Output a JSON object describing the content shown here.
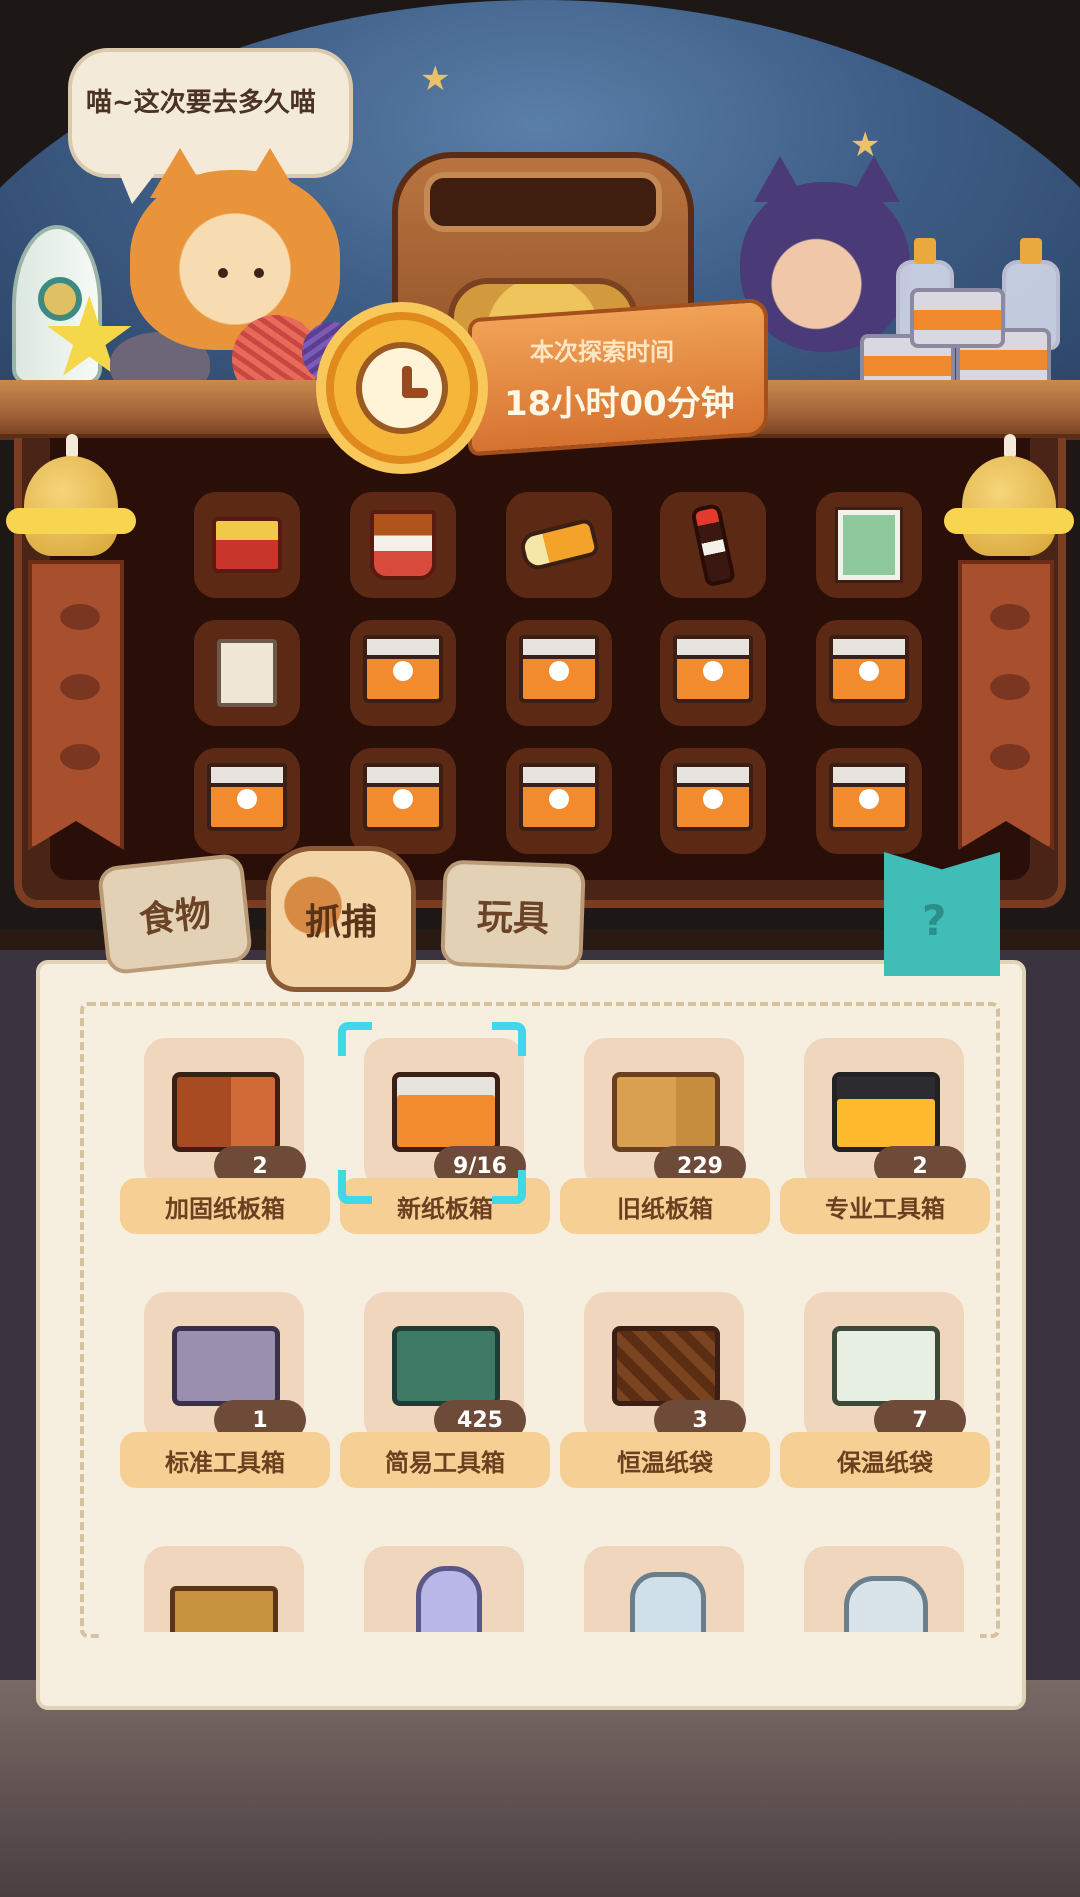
{
  "scene": {
    "speech": "喵~这次要去多久喵",
    "timer_label": "本次探索时间",
    "timer_value": "18小时00分钟"
  },
  "tabs": [
    {
      "label": "食物",
      "selected": false
    },
    {
      "label": "抓捕",
      "selected": true
    },
    {
      "label": "玩具",
      "selected": false
    }
  ],
  "cabinet_items": [
    "food-basket-icon",
    "fried-chicken-bucket-icon",
    "flashlight-icon",
    "soda-bottle-icon",
    "portrait-card-icon",
    "order-note-icon",
    "new-cardboard-box-icon",
    "new-cardboard-box-icon",
    "new-cardboard-box-icon",
    "new-cardboard-box-icon",
    "new-cardboard-box-icon",
    "new-cardboard-box-icon",
    "new-cardboard-box-icon",
    "new-cardboard-box-icon",
    "new-cardboard-box-icon"
  ],
  "items": [
    {
      "name": "加固纸板箱",
      "qty": "2"
    },
    {
      "name": "新纸板箱",
      "qty": "9/16",
      "selected": true
    },
    {
      "name": "旧纸板箱",
      "qty": "229"
    },
    {
      "name": "专业工具箱",
      "qty": "2"
    },
    {
      "name": "标准工具箱",
      "qty": "1"
    },
    {
      "name": "简易工具箱",
      "qty": "425"
    },
    {
      "name": "恒温纸袋",
      "qty": "3"
    },
    {
      "name": "保温纸袋",
      "qty": "7"
    }
  ],
  "colors": {
    "selection": "#41d6e8",
    "tag_bg": "#f6cf95",
    "qty_bg": "#6e4a38"
  }
}
